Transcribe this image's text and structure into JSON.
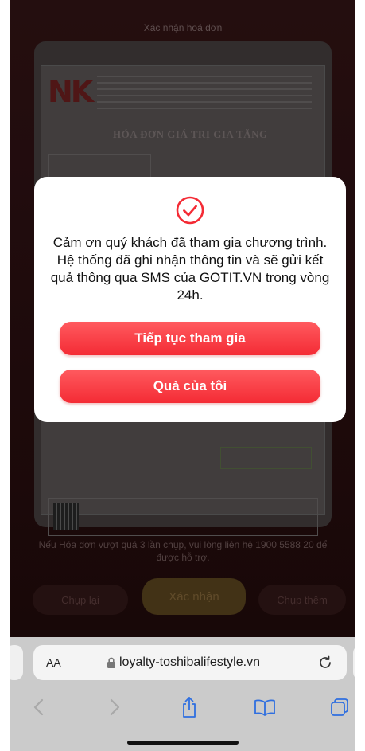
{
  "background_page": {
    "title": "Xác nhận hoá đơn",
    "invoice_heading": "HÓA ĐƠN GIÁ TRỊ GIA TĂNG",
    "help_text": "Nếu Hóa đơn vượt quá 3 lần chụp, vui lòng liên hệ 1900 5588 20 để được hỗ trợ.",
    "buttons": {
      "retake": "Chụp lại",
      "confirm": "Xác nhận",
      "take_more": "Chụp thêm"
    },
    "logo_text": "NK"
  },
  "modal": {
    "message": "Cảm ơn quý khách đã tham gia chương trình. Hệ thống đã ghi nhận thông tin và sẽ gửi kết quả thông qua SMS của GOTIT.VN trong vòng 24h.",
    "primary_button": "Tiếp tục tham gia",
    "secondary_button": "Quà của tôi",
    "icon": "check-circle-icon",
    "accent_color": "#f42b35"
  },
  "browser": {
    "text_size_label": "AA",
    "url": "loyalty-toshibalifestyle.vn",
    "icons": [
      "lock-icon",
      "reload-icon",
      "back-icon",
      "forward-icon",
      "share-icon",
      "bookmarks-icon",
      "tabs-icon"
    ]
  }
}
